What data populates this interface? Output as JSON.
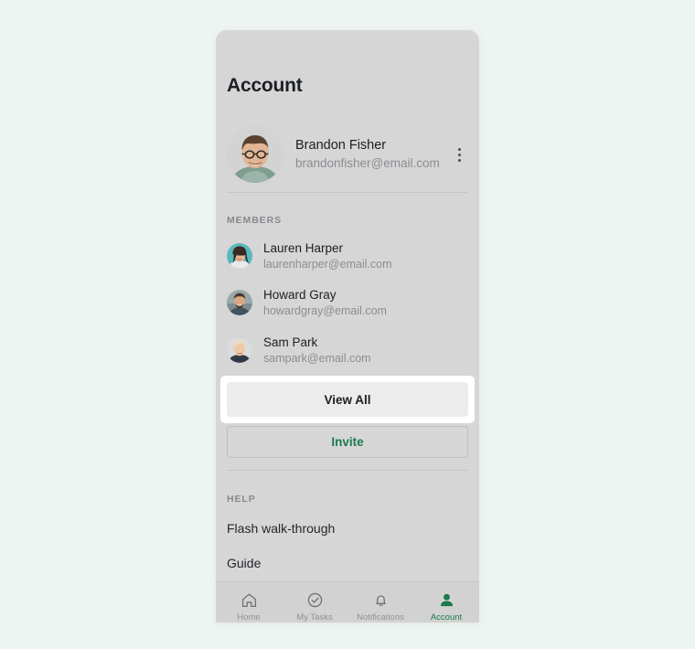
{
  "theme": {
    "page_background": "#eef4f1",
    "panel_background": "#d6d6d6",
    "accent_green": "#1e7a4d",
    "focus_ring": "#ffffff",
    "text_primary": "#1c1f24",
    "text_muted": "#8a8d91"
  },
  "header": {
    "title": "Account"
  },
  "account": {
    "name": "Brandon Fisher",
    "email": "brandonfisher@email.com",
    "avatar_icon": "avatar-photo-brandon",
    "menu_icon": "kebab-menu-icon"
  },
  "members_section": {
    "label": "MEMBERS",
    "items": [
      {
        "name": "Lauren Harper",
        "email": "laurenharper@email.com",
        "avatar_icon": "avatar-photo-lauren"
      },
      {
        "name": "Howard Gray",
        "email": "howardgray@email.com",
        "avatar_icon": "avatar-photo-howard"
      },
      {
        "name": "Sam Park",
        "email": "sampark@email.com",
        "avatar_icon": "avatar-photo-sam"
      }
    ],
    "view_all_label": "View All",
    "invite_label": "Invite"
  },
  "help_section": {
    "label": "HELP",
    "items": [
      {
        "label": "Flash walk-through"
      },
      {
        "label": "Guide"
      }
    ]
  },
  "bottom_nav": {
    "items": [
      {
        "label": "Home",
        "icon": "home-icon",
        "active": false
      },
      {
        "label": "My Tasks",
        "icon": "check-circle-icon",
        "active": false
      },
      {
        "label": "Notifications",
        "icon": "bell-icon",
        "active": false
      },
      {
        "label": "Account",
        "icon": "person-icon",
        "active": true
      }
    ]
  }
}
